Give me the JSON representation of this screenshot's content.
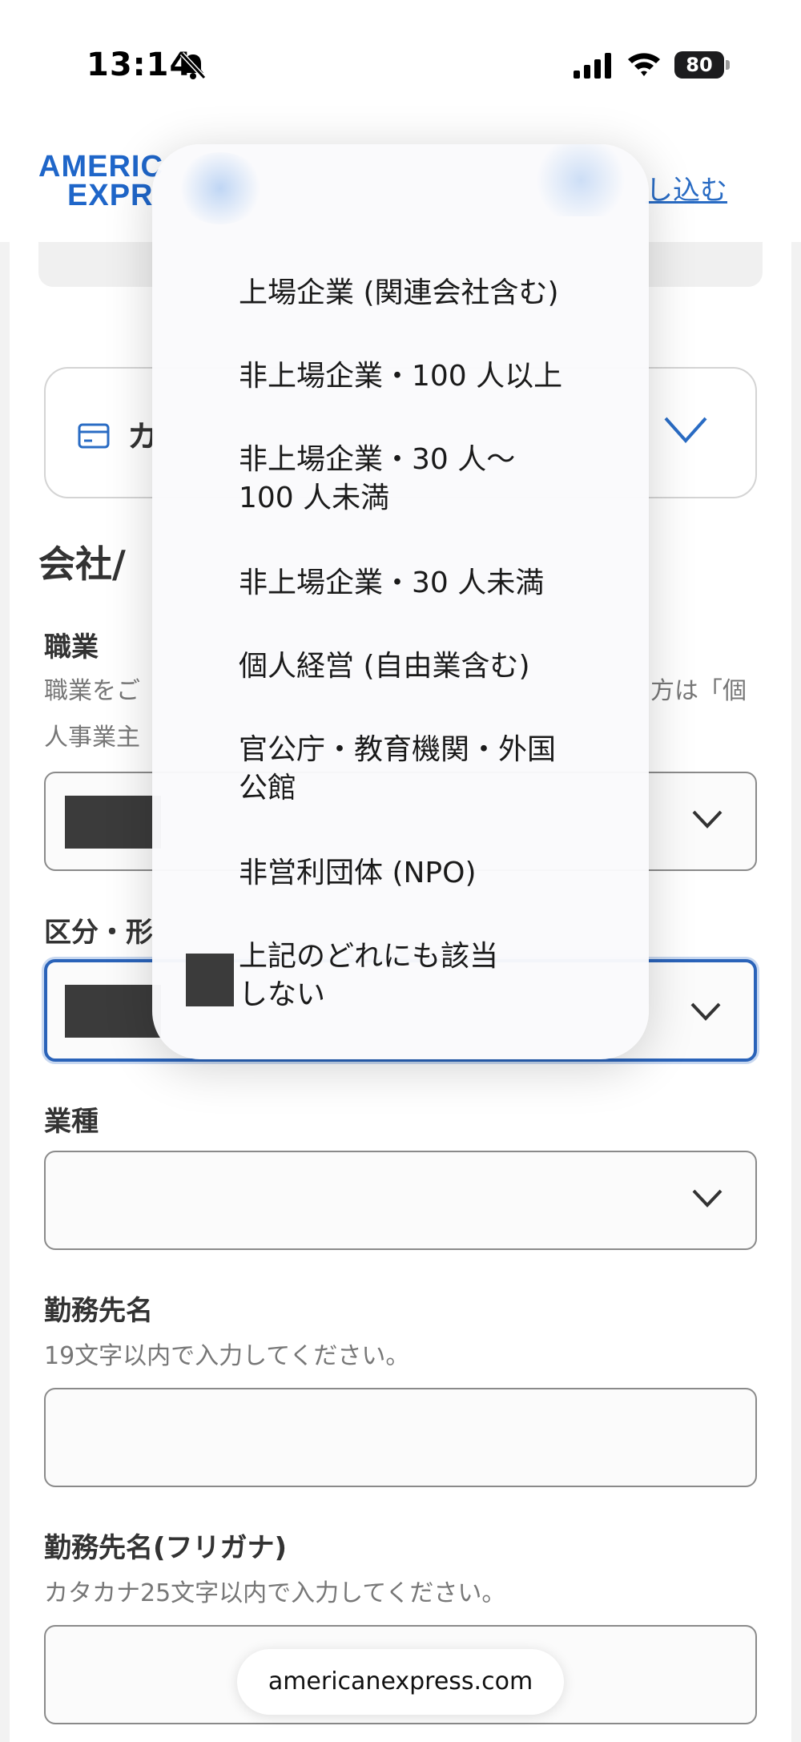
{
  "status_bar": {
    "time": "13:14",
    "battery": "80"
  },
  "header": {
    "logo_line1": "AMERIC",
    "logo_line2": "EXPR",
    "apply_link": "し込む"
  },
  "card_select": {
    "label": "カ"
  },
  "section_title": "会社/",
  "occupation": {
    "label": "職業",
    "helper_line1": "職業をご",
    "helper_line1_end": "方は「個",
    "helper_line2": "人事業主"
  },
  "category": {
    "label": "区分・形"
  },
  "industry": {
    "label": "業種"
  },
  "company_name": {
    "label": "勤務先名",
    "helper": "19文字以内で入力してください。"
  },
  "company_kana": {
    "label": "勤務先名(フリガナ)",
    "helper": "カタカナ25文字以内で入力してください。"
  },
  "dropdown": {
    "items": [
      "上場企業 (関連会社含む)",
      "非上場企業・100 人以上",
      "非上場企業・30 人～\n100 人未満",
      "非上場企業・30 人未満",
      "個人経営 (自由業含む)",
      "官公庁・教育機関・外国\n公館",
      "非営利団体 (NPO)",
      "上記のどれにも該当\nしない"
    ]
  },
  "url_bar": {
    "domain": "americanexpress.com"
  },
  "colors": {
    "brand_blue": "#1f66c9",
    "focus_blue": "#2a63b9",
    "link_blue": "#2a6cc4"
  },
  "icons": [
    "bell-slash-icon",
    "cellular-signal-icon",
    "wifi-icon",
    "battery-icon",
    "credit-card-icon",
    "chevron-down-icon"
  ]
}
